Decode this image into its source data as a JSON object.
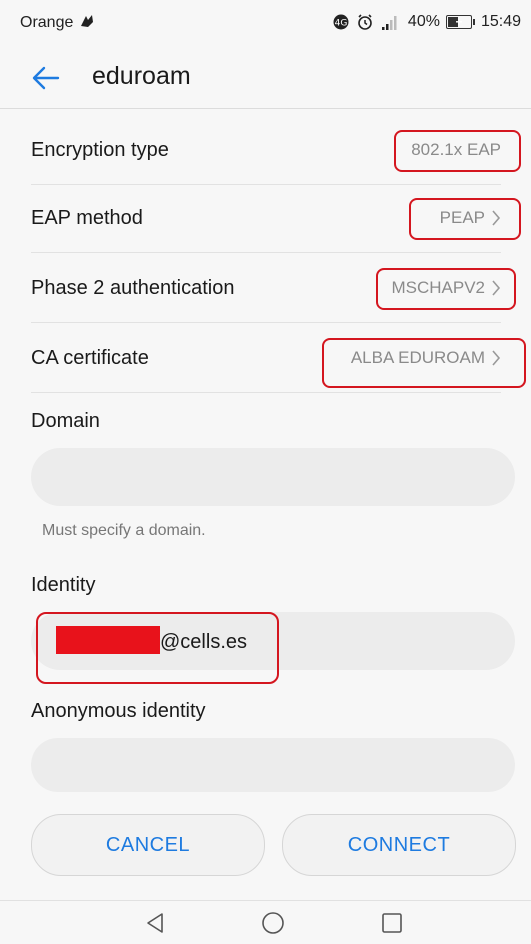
{
  "status_bar": {
    "carrier": "Orange",
    "battery": "40%",
    "time": "15:49",
    "battery_level": 0.4,
    "icons": [
      "carrier-logo-icon",
      "notification-icon",
      "alarm-icon",
      "signal-icon",
      "battery-charging-icon"
    ]
  },
  "app_bar": {
    "title": "eduroam",
    "back_icon": "arrow-left-icon"
  },
  "settings": [
    {
      "label": "Encryption type",
      "value": "802.1x EAP",
      "has_chevron": false
    },
    {
      "label": "EAP method",
      "value": "PEAP",
      "has_chevron": true
    },
    {
      "label": "Phase 2 authentication",
      "value": "MSCHAPV2",
      "has_chevron": true
    },
    {
      "label": "CA certificate",
      "value": "ALBA EDUROAM",
      "has_chevron": true
    }
  ],
  "domain": {
    "label": "Domain",
    "value": "",
    "helper": "Must specify a domain."
  },
  "identity": {
    "label": "Identity",
    "value": "@cells.es"
  },
  "anonymous_identity": {
    "label": "Anonymous identity",
    "value": ""
  },
  "actions": {
    "cancel": "CANCEL",
    "connect": "CONNECT"
  },
  "nav": {
    "icons": [
      "back-triangle-icon",
      "home-circle-icon",
      "recents-square-icon"
    ]
  },
  "colors": {
    "accent": "#1e7be0",
    "annotation": "#d4161f"
  }
}
